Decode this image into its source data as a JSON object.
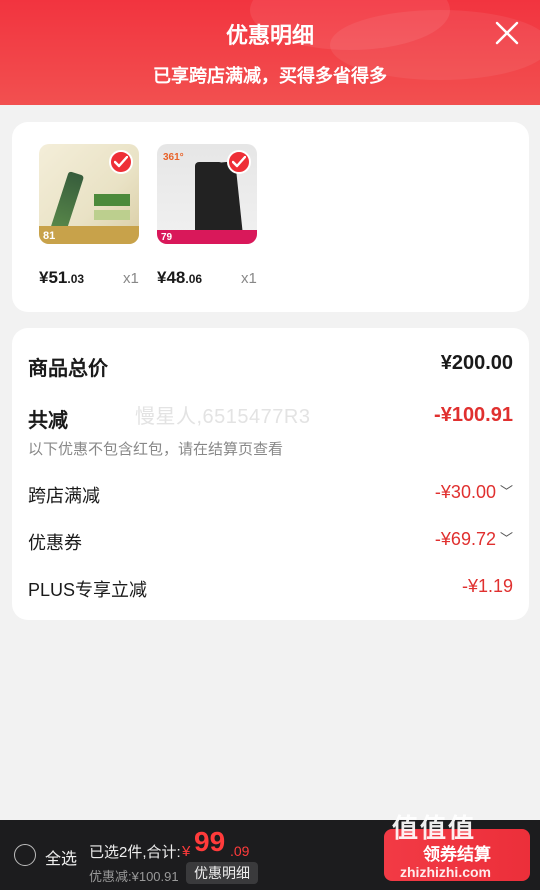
{
  "header": {
    "title": "优惠明细",
    "subtitle": "已享跨店满减，买得多省得多",
    "close_icon": "close-icon"
  },
  "products": [
    {
      "price_int": "¥51",
      "price_dec": ".03",
      "qty": "x1",
      "banner_text": "81"
    },
    {
      "price_int": "¥48",
      "price_dec": ".06",
      "qty": "x1",
      "banner_text": "79",
      "brand": "361°"
    }
  ],
  "summary": {
    "total_label": "商品总价",
    "total_value": "¥200.00",
    "reduce_label": "共减",
    "reduce_value": "-¥100.91",
    "note": "以下优惠不包含红包，请在结算页查看",
    "items": [
      {
        "label": "跨店满减",
        "value": "-¥30.00"
      },
      {
        "label": "优惠券",
        "value": "-¥69.72"
      },
      {
        "label": "PLUS专享立减",
        "value": "-¥1.19"
      }
    ]
  },
  "watermark": "慢星人,6515477R3",
  "footer": {
    "select_all": "全选",
    "selected_info": "已选2件,合计:",
    "currency": "¥",
    "total_int": "99",
    "total_dec": ".09",
    "discount_info": "优惠减:¥100.91",
    "detail_button": "优惠明细",
    "checkout_button": "领券结算"
  },
  "corner_watermark": {
    "logo": "值值值",
    "url": "zhizhizhi.com"
  },
  "colors": {
    "header_red": "#f2343f",
    "accent_red": "#e0302f",
    "footer_bg": "#1c1c1e"
  }
}
